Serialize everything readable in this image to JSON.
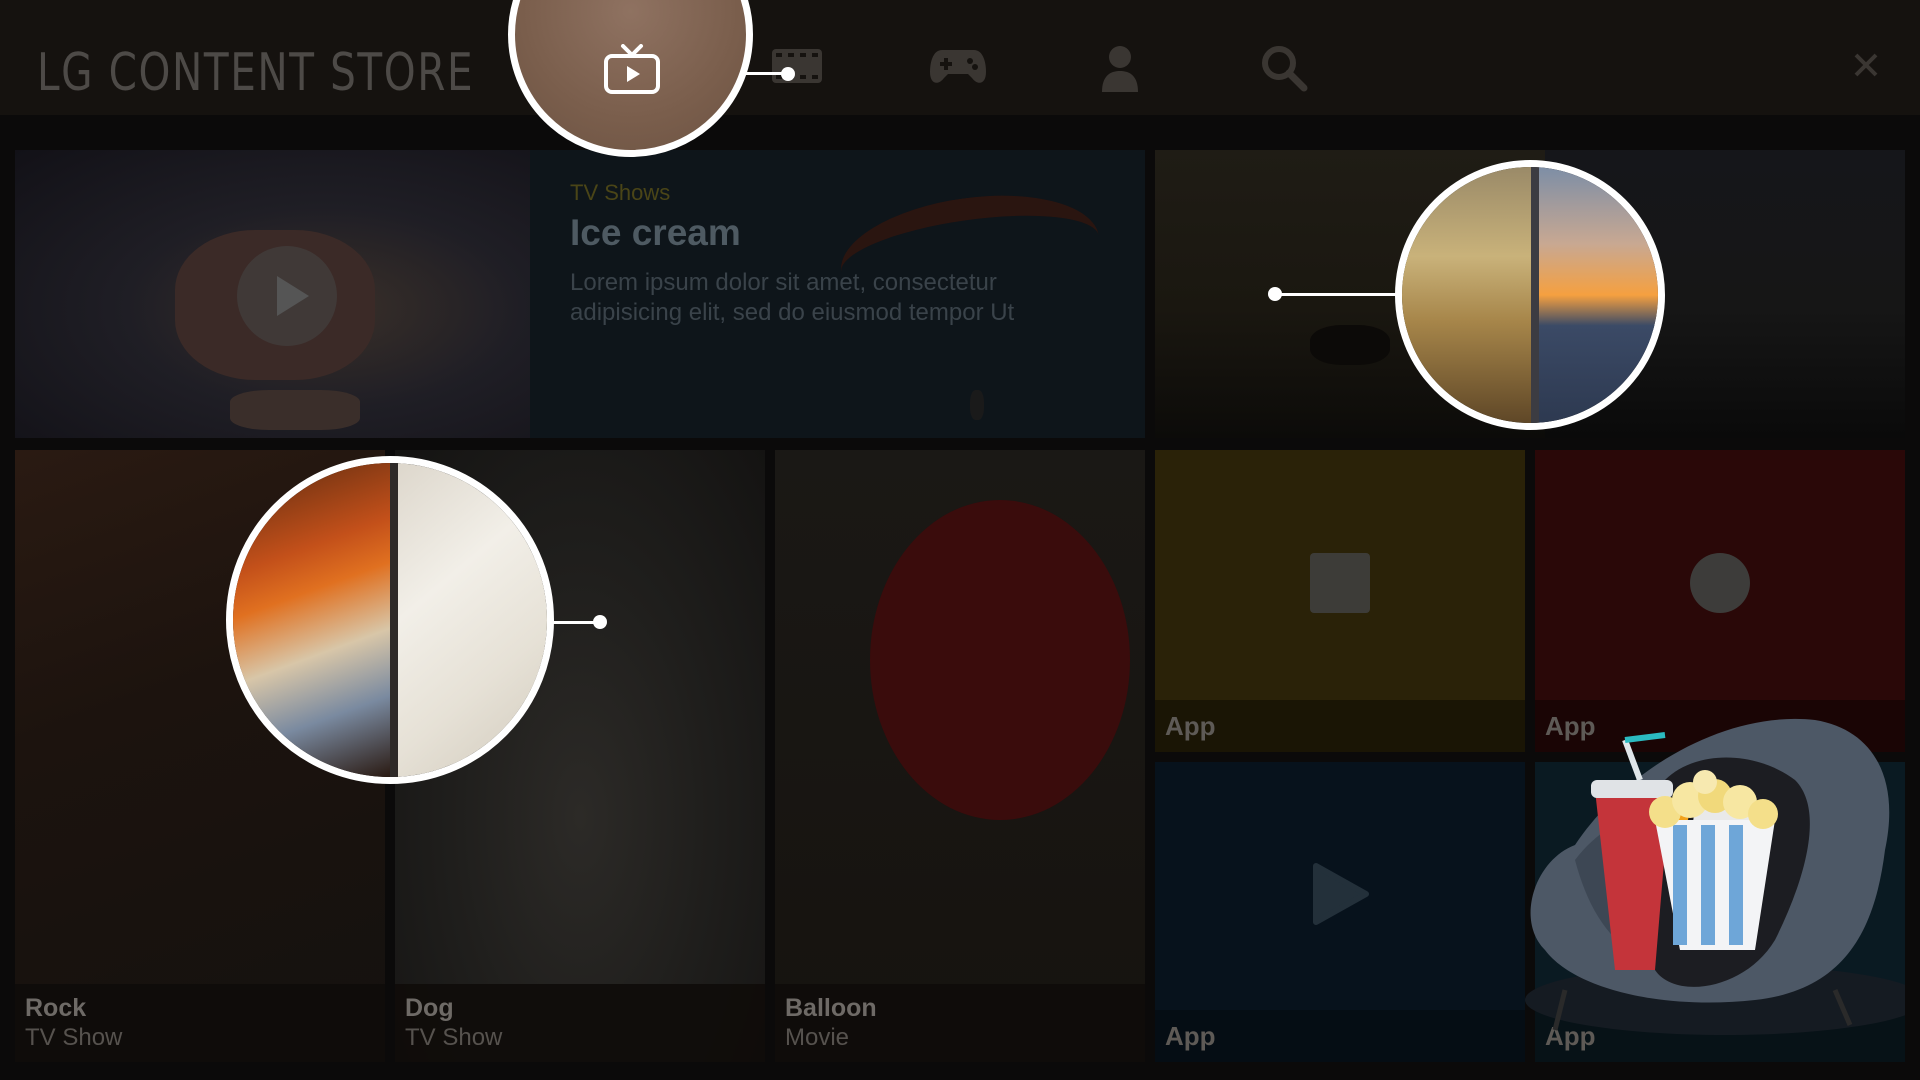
{
  "header": {
    "brand": "LG CONTENT STORE",
    "nav": [
      {
        "name": "tv-icon",
        "active": true
      },
      {
        "name": "movie-icon",
        "active": false
      },
      {
        "name": "gamepad-icon",
        "active": false
      },
      {
        "name": "user-icon",
        "active": false
      },
      {
        "name": "search-icon",
        "active": false
      }
    ],
    "close_icon": "close-icon"
  },
  "featured": {
    "category": "TV Shows",
    "title": "Ice cream",
    "description_line1": "Lorem ipsum dolor sit amet, consectetur",
    "description_line2": "adipisicing elit, sed do eiusmod tempor Ut",
    "play_icon": "play-icon"
  },
  "tiles": [
    {
      "title": "Rock",
      "subtitle": "TV Show"
    },
    {
      "title": "Dog",
      "subtitle": "TV Show"
    },
    {
      "title": "Balloon",
      "subtitle": "Movie"
    }
  ],
  "apps": [
    {
      "label": "App",
      "icon": "square-icon",
      "color": "#2a2208"
    },
    {
      "label": "App",
      "icon": "circle-icon",
      "color": "#2a0808"
    },
    {
      "label": "App",
      "icon": "play-icon",
      "color": "#07121c"
    },
    {
      "label": "App",
      "icon": "app-icon",
      "color": "#0a1a22"
    }
  ],
  "colors": {
    "background": "#0b0a0a",
    "active_nav": "#8a6c55",
    "highlight_ring": "#ffffff"
  },
  "mascot": {
    "name": "penguin-with-popcorn-illustration"
  }
}
